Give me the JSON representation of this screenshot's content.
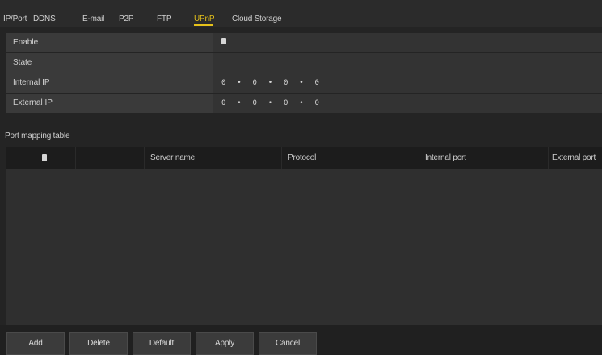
{
  "tabs": [
    {
      "label": "IP/Port",
      "active": false
    },
    {
      "label": "DDNS",
      "active": false
    },
    {
      "label": "E-mail",
      "active": false
    },
    {
      "label": "P2P",
      "active": false
    },
    {
      "label": "FTP",
      "active": false
    },
    {
      "label": "UPnP",
      "active": true
    },
    {
      "label": "Cloud Storage",
      "active": false
    }
  ],
  "form": {
    "enable": {
      "label": "Enable",
      "checked": true
    },
    "state": {
      "label": "State",
      "value": ""
    },
    "internal_ip": {
      "label": "Internal IP",
      "value": "0  •  0  •  0  •  0"
    },
    "external_ip": {
      "label": "External IP",
      "value": "0  •  0  •  0  •  0"
    }
  },
  "port_mapping": {
    "title": "Port mapping table",
    "columns": [
      "Server name",
      "Protocol",
      "Internal port",
      "External port"
    ],
    "rows": []
  },
  "buttons": {
    "add": "Add",
    "delete": "Delete",
    "default": "Default",
    "apply": "Apply",
    "cancel": "Cancel"
  },
  "colors": {
    "accent": "#e6c21a",
    "background": "#242424"
  }
}
